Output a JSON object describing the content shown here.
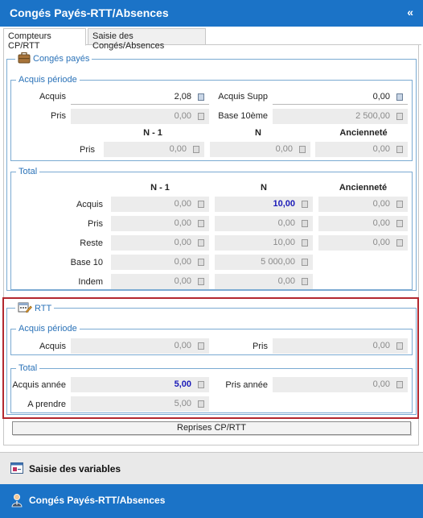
{
  "window": {
    "title": "Congés Payés-RTT/Absences",
    "collapse_glyph": "«"
  },
  "tabs": [
    {
      "label": "Compteurs CP/RTT",
      "active": true
    },
    {
      "label": "Saisie des Congés/Absences",
      "active": false
    }
  ],
  "conges": {
    "legend": "Congés payés",
    "icon": "suitcase-icon",
    "acquis_periode": {
      "legend": "Acquis période",
      "acquis_label": "Acquis",
      "acquis": "2,08",
      "acquis_supp_label": "Acquis Supp",
      "acquis_supp": "0,00",
      "pris_label": "Pris",
      "pris": "0,00",
      "base10_label": "Base 10ème",
      "base10": "2 500,00",
      "col_n1": "N - 1",
      "col_n": "N",
      "col_anc": "Ancienneté",
      "pris_row_label": "Pris",
      "pris_n1": "0,00",
      "pris_n": "0,00",
      "pris_anc": "0,00"
    },
    "total": {
      "legend": "Total",
      "col_n1": "N - 1",
      "col_n": "N",
      "col_anc": "Ancienneté",
      "rows": [
        {
          "label": "Acquis",
          "n1": "0,00",
          "n": "10,00",
          "anc": "0,00"
        },
        {
          "label": "Pris",
          "n1": "0,00",
          "n": "0,00",
          "anc": "0,00"
        },
        {
          "label": "Reste",
          "n1": "0,00",
          "n": "10,00",
          "anc": "0,00"
        },
        {
          "label": "Base 10",
          "n1": "0,00",
          "n": "5 000,00"
        },
        {
          "label": "Indem",
          "n1": "0,00",
          "n": "0,00"
        }
      ]
    }
  },
  "rtt": {
    "legend": "RTT",
    "icon": "calendar-edit-icon",
    "acquis_periode": {
      "legend": "Acquis période",
      "acquis_label": "Acquis",
      "acquis": "0,00",
      "pris_label": "Pris",
      "pris": "0,00"
    },
    "total": {
      "legend": "Total",
      "acquis_annee_label": "Acquis année",
      "acquis_annee": "5,00",
      "pris_annee_label": "Pris année",
      "pris_annee": "0,00",
      "a_prendre_label": "A prendre",
      "a_prendre": "5,00"
    }
  },
  "buttons": {
    "reprises": "Reprises CP/RTT"
  },
  "nav": [
    {
      "label": "Saisie des variables",
      "icon": "variables-window-icon",
      "active": false
    },
    {
      "label": "Congés Payés-RTT/Absences",
      "icon": "person-icon",
      "active": true
    }
  ],
  "colors": {
    "accent": "#1b73c7",
    "highlight_border": "#b3282f",
    "value_emphasis": "#1a1ab8"
  }
}
